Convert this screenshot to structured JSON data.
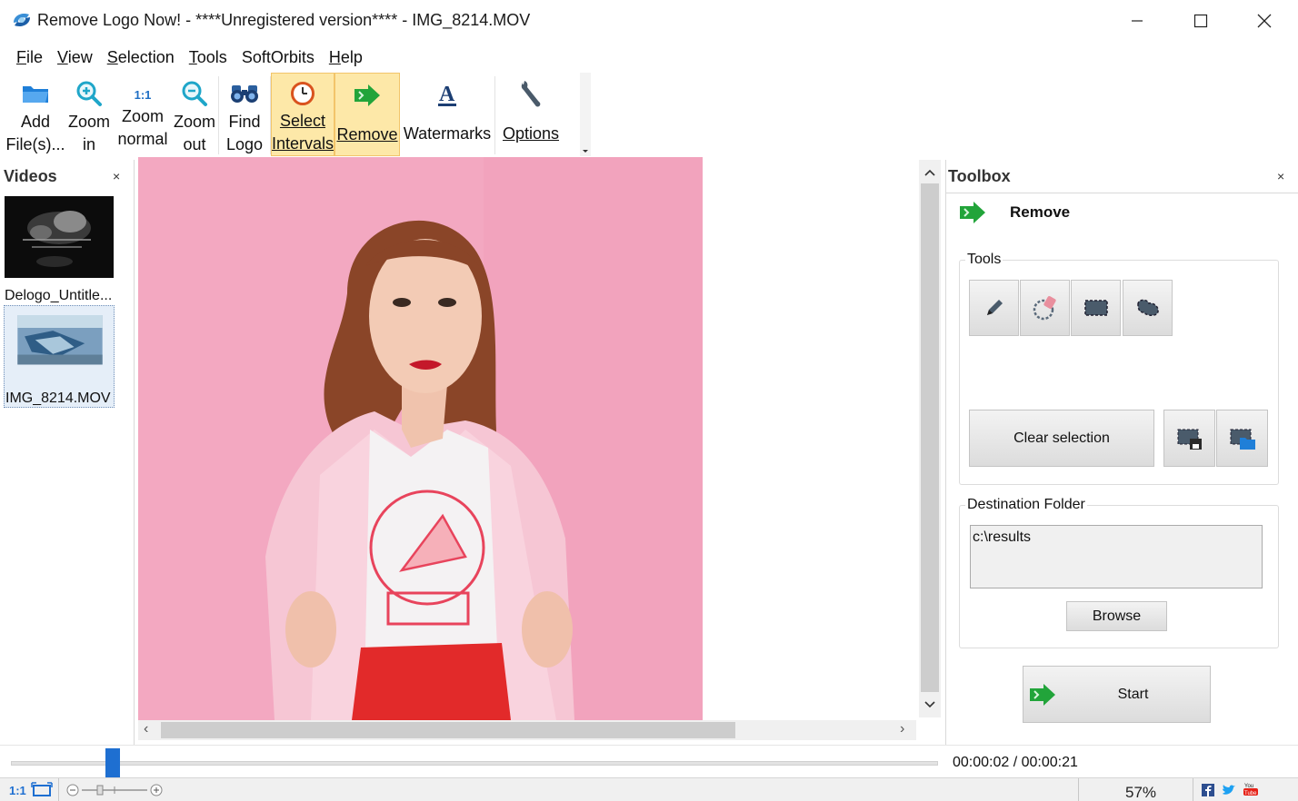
{
  "window": {
    "title": "Remove Logo Now! - ****Unregistered version**** - IMG_8214.MOV"
  },
  "menu": [
    {
      "first": "F",
      "rest": "ile"
    },
    {
      "first": "V",
      "rest": "iew"
    },
    {
      "first": "S",
      "rest": "election"
    },
    {
      "first": "T",
      "rest": "ools"
    },
    {
      "first": "",
      "rest": "SoftOrbits"
    },
    {
      "first": "H",
      "rest": "elp"
    }
  ],
  "toolbar": {
    "add_files": {
      "line1": "Add",
      "line2": "File(s)..."
    },
    "zoom_in": {
      "line1": "Zoom",
      "line2": "in"
    },
    "zoom_normal": {
      "icon_text": "1:1",
      "line1": "Zoom",
      "line2": "normal"
    },
    "zoom_out": {
      "line1": "Zoom",
      "line2": "out"
    },
    "find_logo": {
      "line1": "Find",
      "line2": "Logo"
    },
    "select_intervals": {
      "line1": "Select",
      "line2": "Intervals"
    },
    "remove": {
      "label": "Remove"
    },
    "watermarks": {
      "label": "Watermarks"
    },
    "options": {
      "label": "Options"
    }
  },
  "videos_panel": {
    "title": "Videos",
    "close": "×",
    "items": [
      {
        "name": "Delogo_Untitle..."
      },
      {
        "name": "IMG_8214.MOV"
      }
    ]
  },
  "toolbox": {
    "title": "Toolbox",
    "close": "×",
    "section_title": "Remove",
    "tools_legend": "Tools",
    "clear_selection": "Clear selection",
    "destination_legend": "Destination Folder",
    "destination_value": "c:\\results",
    "browse": "Browse",
    "start": "Start"
  },
  "timeline": {
    "time": "00:00:02 / 00:00:21",
    "position": 0.11
  },
  "statusbar": {
    "zoom_label": "1:1",
    "zoom_percent": "57%"
  },
  "colors": {
    "accent": "#1e6fd1",
    "active_button": "#fde8a8",
    "photo_background": "#f3a8c1"
  }
}
